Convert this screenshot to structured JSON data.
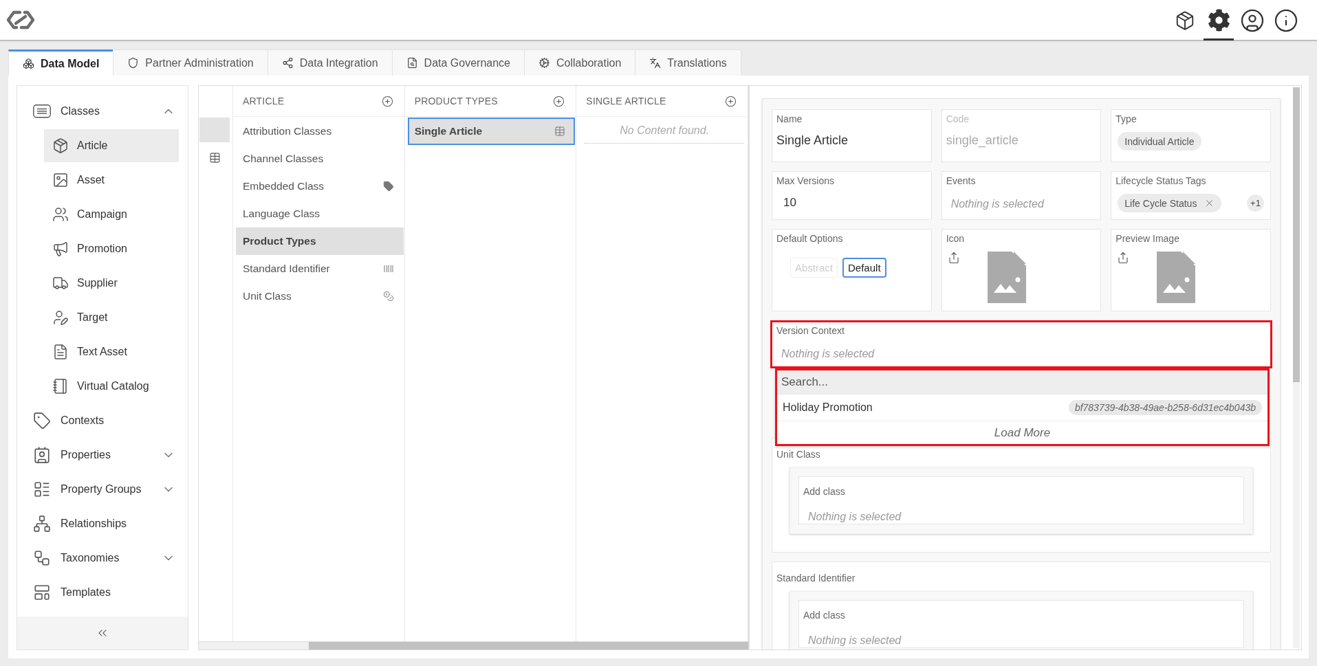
{
  "header": {
    "icons": [
      {
        "kind": "package",
        "selected": false
      },
      {
        "kind": "settings",
        "selected": true
      },
      {
        "kind": "user",
        "selected": false
      },
      {
        "kind": "info",
        "selected": false
      }
    ]
  },
  "tabs": [
    {
      "label": "Data Model",
      "selected": true
    },
    {
      "label": "Partner Administration",
      "selected": false
    },
    {
      "label": "Data Integration",
      "selected": false
    },
    {
      "label": "Data Governance",
      "selected": false
    },
    {
      "label": "Collaboration",
      "selected": false
    },
    {
      "label": "Translations",
      "selected": false
    }
  ],
  "sidebar": {
    "items": [
      {
        "label": "Classes",
        "selected": false,
        "expanded": true,
        "children": [
          {
            "label": "Article",
            "selected": true
          },
          {
            "label": "Asset",
            "selected": false
          },
          {
            "label": "Campaign",
            "selected": false
          },
          {
            "label": "Promotion",
            "selected": false
          },
          {
            "label": "Supplier",
            "selected": false
          },
          {
            "label": "Target",
            "selected": false
          },
          {
            "label": "Text Asset",
            "selected": false
          },
          {
            "label": "Virtual Catalog",
            "selected": false
          }
        ]
      },
      {
        "label": "Contexts",
        "selected": false
      },
      {
        "label": "Properties",
        "selected": false,
        "expanded": false
      },
      {
        "label": "Property Groups",
        "selected": false,
        "expanded": false
      },
      {
        "label": "Relationships",
        "selected": false
      },
      {
        "label": "Taxonomies",
        "selected": false,
        "expanded": false
      },
      {
        "label": "Templates",
        "selected": false
      }
    ]
  },
  "browser": {
    "rail": [
      {
        "selected": true
      },
      {
        "selected": false
      }
    ],
    "columns": [
      {
        "title": "ARTICLE",
        "items": [
          {
            "label": "Attribution Classes",
            "selected": false,
            "focused": false
          },
          {
            "label": "Channel Classes",
            "selected": false,
            "focused": false
          },
          {
            "label": "Embedded Class",
            "selected": false,
            "focused": false
          },
          {
            "label": "Language Class",
            "selected": false,
            "focused": false
          },
          {
            "label": "Product Types",
            "selected": true,
            "focused": false
          },
          {
            "label": "Standard Identifier",
            "selected": false,
            "focused": false
          },
          {
            "label": "Unit Class",
            "selected": false,
            "focused": false
          }
        ]
      },
      {
        "title": "PRODUCT TYPES",
        "items": [
          {
            "label": "Single Article",
            "selected": true,
            "focused": true
          }
        ]
      },
      {
        "title": "SINGLE ARTICLE",
        "empty_text": "No Content found."
      }
    ]
  },
  "details": {
    "rows": [
      [
        {
          "kind": "text",
          "label": "Name",
          "value": "Single Article",
          "disabled": false
        },
        {
          "kind": "text",
          "label": "Code",
          "value": "single_article",
          "disabled": true
        },
        {
          "kind": "chips",
          "label": "Type",
          "chips": [
            {
              "label": "Individual Article",
              "removable": false
            }
          ],
          "disabled": false
        }
      ],
      [
        {
          "kind": "number",
          "label": "Max Versions",
          "value": "10",
          "disabled": false
        },
        {
          "kind": "select",
          "label": "Events",
          "placeholder": "Nothing is selected",
          "disabled": false
        },
        {
          "kind": "chips",
          "label": "Lifecycle Status Tags",
          "chips": [
            {
              "label": "Life Cycle Status",
              "removable": true
            }
          ],
          "more": "+1",
          "disabled": false
        }
      ],
      [
        {
          "kind": "options",
          "label": "Default Options",
          "options": [
            {
              "label": "Abstract",
              "selected": false
            },
            {
              "label": "Default",
              "selected": true
            }
          ],
          "disabled": false
        },
        {
          "kind": "image",
          "label": "Icon",
          "disabled": false
        },
        {
          "kind": "image",
          "label": "Preview Image",
          "disabled": false
        }
      ]
    ],
    "version_context": {
      "label": "Version Context",
      "placeholder": "Nothing is selected",
      "highlighted": true,
      "expanded": true,
      "dropdown": {
        "search_placeholder": "Search...",
        "options": [
          {
            "label": "Holiday Promotion",
            "id": "bf783739-4b38-49ae-b258-6d31ec4b043b"
          }
        ],
        "load_more": "Load More",
        "highlighted": true
      }
    },
    "sections": [
      {
        "label": "Unit Class",
        "field_label": "Add class",
        "placeholder": "Nothing is selected"
      },
      {
        "label": "Standard Identifier",
        "field_label": "Add class",
        "placeholder": "Nothing is selected"
      }
    ]
  }
}
